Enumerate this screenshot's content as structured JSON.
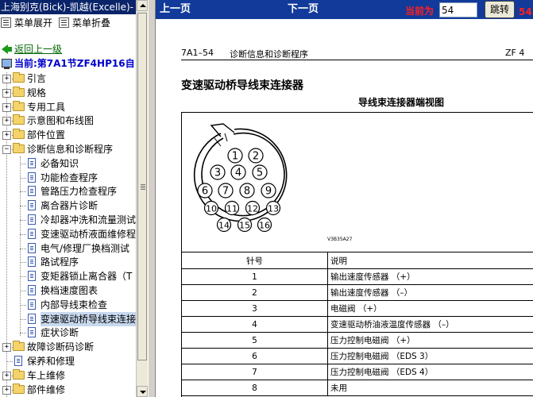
{
  "left": {
    "title": "上海别克(Bick)-凯越(Excelle)-",
    "expand_all": "菜单展开",
    "collapse_all": "菜单折叠",
    "back": "返回上一级",
    "current": "当前:第7A1节ZF4HP16自",
    "tree": [
      {
        "label": "引言"
      },
      {
        "label": "规格"
      },
      {
        "label": "专用工具"
      },
      {
        "label": "示意图和布线图"
      },
      {
        "label": "部件位置"
      },
      {
        "label": "诊断信息和诊断程序"
      },
      {
        "label": "必备知识"
      },
      {
        "label": "功能检查程序"
      },
      {
        "label": "管路压力检查程序"
      },
      {
        "label": "离合器片诊断"
      },
      {
        "label": "冷却器冲洗和流量测试"
      },
      {
        "label": "变速驱动桥液面维修程"
      },
      {
        "label": "电气/修理厂换档测试"
      },
      {
        "label": "路试程序"
      },
      {
        "label": "变矩器锁止离合器（T"
      },
      {
        "label": "换档速度图表"
      },
      {
        "label": "内部导线束检查"
      },
      {
        "label": "变速驱动桥导线束连接"
      },
      {
        "label": "症状诊断"
      },
      {
        "label": "故障诊断码诊断"
      },
      {
        "label": "保养和修理"
      },
      {
        "label": "车上维修"
      },
      {
        "label": "部件维修"
      }
    ]
  },
  "toolbar": {
    "prev": "上一页",
    "next": "下一页",
    "current_label": "当前为",
    "page_value": "54",
    "jump": "跳转",
    "total": "54"
  },
  "doc": {
    "header_code": "7A1–54",
    "header_title": "诊断信息和诊断程序",
    "header_right": "ZF 4",
    "section_title": "变速驱动桥导线束连接器",
    "view_title": "导线束连接器端视图",
    "figure_code": "V3B35A27",
    "pins": [
      "1",
      "2",
      "3",
      "4",
      "5",
      "6",
      "7",
      "8",
      "9",
      "10",
      "11",
      "12",
      "13",
      "14",
      "15",
      "16"
    ],
    "table": {
      "headers": [
        "针号",
        "说明"
      ],
      "rows": [
        [
          "1",
          "输出速度传感器 （+）"
        ],
        [
          "2",
          "输出速度传感器 （–）"
        ],
        [
          "3",
          "电磁阀 （+）"
        ],
        [
          "4",
          "变速驱动桥油液温度传感器 （–）"
        ],
        [
          "5",
          "压力控制电磁阀 （+）"
        ],
        [
          "6",
          "压力控制电磁阀 （EDS 3）"
        ],
        [
          "7",
          "压力控制电磁阀 （EDS 4）"
        ],
        [
          "8",
          "未用"
        ]
      ]
    }
  }
}
